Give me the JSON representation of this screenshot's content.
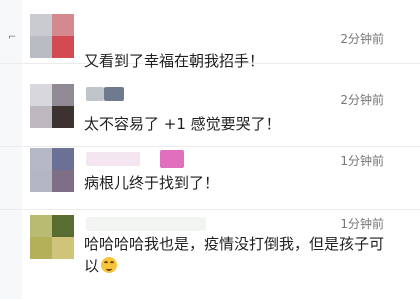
{
  "comments": [
    {
      "time": "2分钟前",
      "text": "又看到了幸福在朝我招手！",
      "avatar_colors": [
        "#c9cbd1",
        "#d4898f",
        "#b9bcc3",
        "#d34a52"
      ],
      "name_colors": [
        "#ffffff"
      ]
    },
    {
      "time": "2分钟前",
      "text": "太不容易了 +1 感觉要哭了！",
      "avatar_colors": [
        "#d8d7db",
        "#8f8a93",
        "#bcb8bd",
        "#3c3330"
      ],
      "name_colors": [
        "#bfc4cb",
        "#6f7a8d"
      ]
    },
    {
      "time": "1分钟前",
      "text": "病根儿终于找到了！",
      "avatar_colors": [
        "#b6b9c5",
        "#6b7195",
        "#b5b6c3",
        "#7e6f86"
      ],
      "name_colors": [
        "#f3e6f0",
        "#e06fbe"
      ]
    },
    {
      "time": "1分钟前",
      "text": "哈哈哈哈我也是，疫情没打倒我，但是孩子可以",
      "avatar_colors": [
        "#b9bb72",
        "#596d32",
        "#b4b05a",
        "#cfc47a"
      ],
      "name_colors": [
        "#f2f4f2"
      ],
      "emoji": "laugh-cry"
    }
  ]
}
